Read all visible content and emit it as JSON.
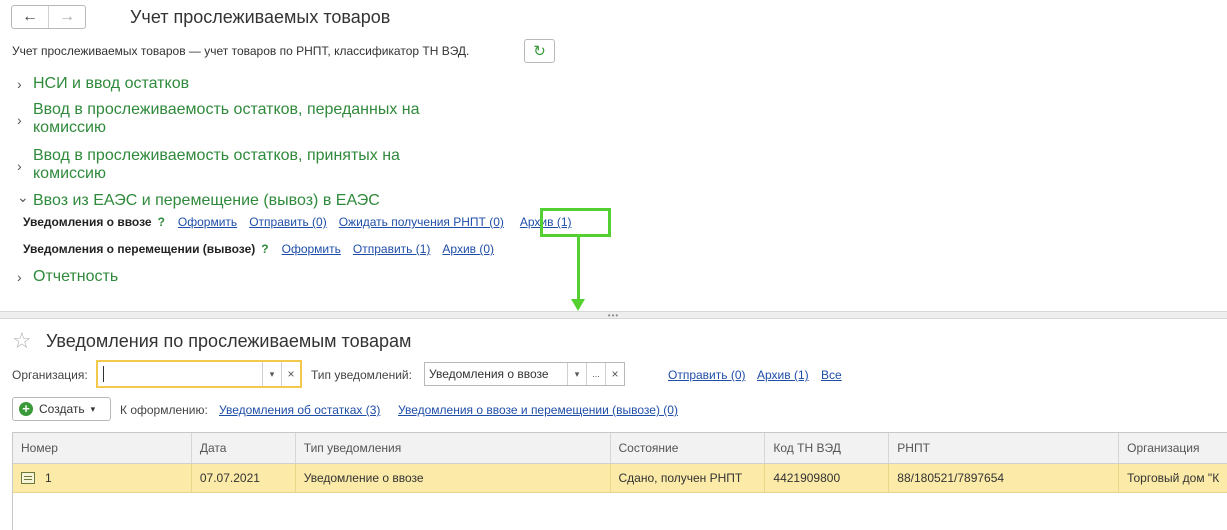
{
  "window": {
    "title": "Учет прослеживаемых товаров",
    "back_icon": "←",
    "forward_icon": "→",
    "subtitle": "Учет прослеживаемых товаров — учет товаров по РНПТ, классификатор ТН ВЭД.",
    "refresh_icon": "↻"
  },
  "groups": [
    {
      "label": "НСИ и ввод остатков",
      "state": "collapsed"
    },
    {
      "label": "Ввод в прослеживаемость остатков, переданных на комиссию",
      "state": "collapsed"
    },
    {
      "label": "Ввод в прослеживаемость остатков, принятых на комиссию",
      "state": "collapsed"
    },
    {
      "label": "Ввоз из ЕАЭС и перемещение (вывоз) в ЕАЭС",
      "state": "expanded"
    },
    {
      "label": "Отчетность",
      "state": "collapsed"
    }
  ],
  "chevrons": {
    "collapsed": "›",
    "expanded": "⌄"
  },
  "import_row": {
    "label": "Уведомления о ввозе",
    "help": "?",
    "links": [
      "Оформить",
      "Отправить (0)",
      "Ожидать получения РНПТ (0)",
      "Архив (1)"
    ]
  },
  "transfer_row": {
    "label": "Уведомления о перемещении (вывозе)",
    "help": "?",
    "links": [
      "Оформить",
      "Отправить (1)",
      "Архив (0)"
    ]
  },
  "splitter_grip": "•••",
  "form": {
    "title": "Уведомления по прослеживаемым товарам",
    "star_icon": "☆",
    "org_label": "Организация:",
    "org_value": "",
    "type_label": "Тип уведомлений:",
    "type_value": "Уведомления о ввозе",
    "dropdown_icon": "▾",
    "more_icon": "...",
    "clear_icon": "×",
    "filter_links": [
      "Отправить (0)",
      "Архив (1)",
      "Все"
    ],
    "create_label": "Создать",
    "create_plus": "+",
    "to_process_label": "К оформлению:",
    "to_process_links": [
      "Уведомления об остатках (3)",
      "Уведомления о ввозе и перемещении (вывозе) (0)"
    ]
  },
  "table": {
    "columns": [
      "Номер",
      "Дата",
      "Тип уведомления",
      "Состояние",
      "Код ТН ВЭД",
      "РНПТ",
      "Организация"
    ],
    "rows": [
      [
        "1",
        "07.07.2021",
        "Уведомление о ввозе",
        "Сдано, получен РНПТ",
        "4421909800",
        "88/180521/7897654",
        "Торговый дом \"К"
      ]
    ]
  },
  "colors": {
    "accent_green": "#2f8a3b",
    "link_blue": "#1f4ea8",
    "highlight_green": "#55d032",
    "selected_row": "#fbeaa8"
  }
}
